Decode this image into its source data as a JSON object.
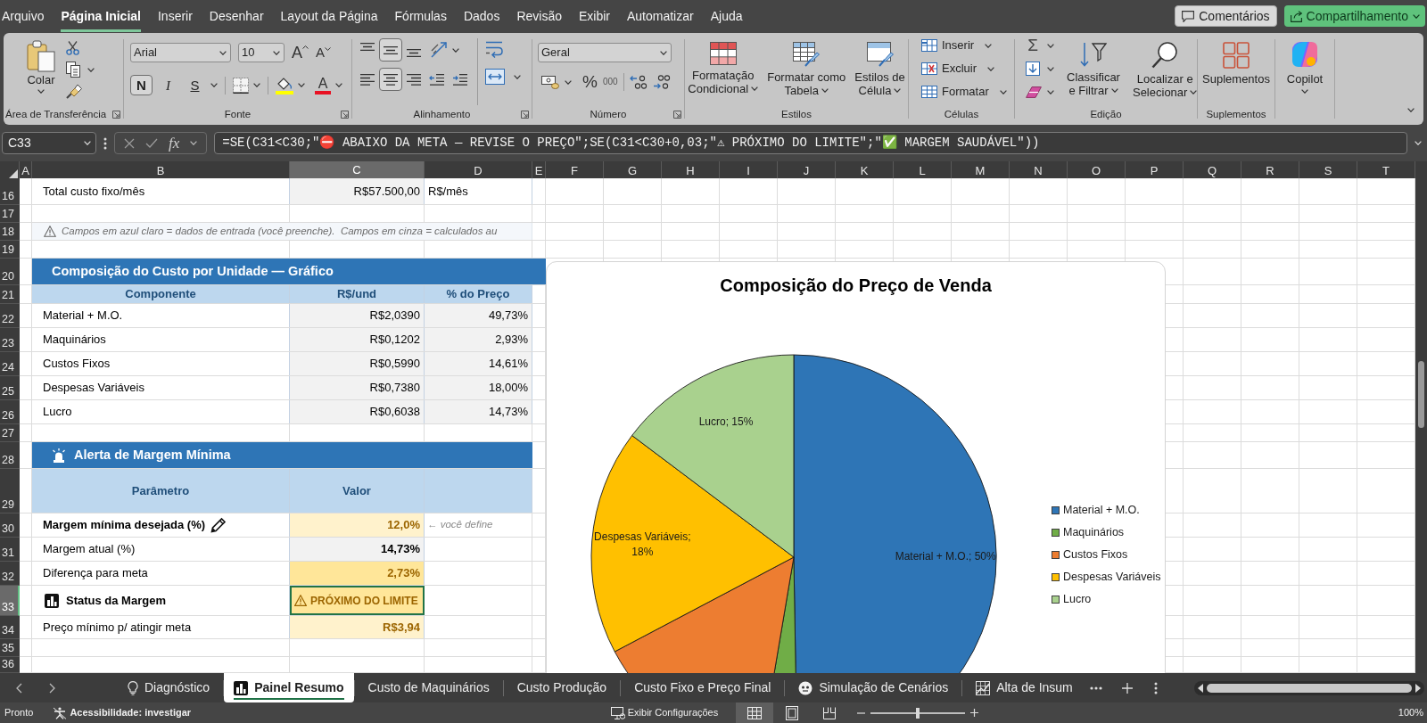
{
  "menu_tabs": [
    {
      "label": "Arquivo",
      "selected": false
    },
    {
      "label": "Página Inicial",
      "selected": true
    },
    {
      "label": "Inserir",
      "selected": false
    },
    {
      "label": "Desenhar",
      "selected": false
    },
    {
      "label": "Layout da Página",
      "selected": false
    },
    {
      "label": "Fórmulas",
      "selected": false
    },
    {
      "label": "Dados",
      "selected": false
    },
    {
      "label": "Revisão",
      "selected": false
    },
    {
      "label": "Exibir",
      "selected": false
    },
    {
      "label": "Automatizar",
      "selected": false
    },
    {
      "label": "Ajuda",
      "selected": false
    }
  ],
  "header_buttons": [
    {
      "kind": "comments",
      "label": "Comentários"
    },
    {
      "kind": "share",
      "label": "Compartilhamento"
    }
  ],
  "ribbon": {
    "groups": [
      {
        "kind": "clipboard",
        "label": "Área de Transferência",
        "launcher": true,
        "paste": "Colar"
      },
      {
        "kind": "font",
        "label": "Fonte",
        "launcher": true,
        "font_name": "Arial",
        "font_size": "10",
        "grow": "A",
        "shrink": "A",
        "styles": [
          {
            "kind": "bold",
            "label": "N",
            "selected": true
          },
          {
            "kind": "italic",
            "label": "I",
            "selected": false
          },
          {
            "kind": "underline",
            "label": "S",
            "selected": false
          }
        ],
        "font_color": "A"
      },
      {
        "kind": "alignment",
        "label": "Alinhamento",
        "launcher": true,
        "vertical": [
          {
            "kind": "top",
            "selected": false
          },
          {
            "kind": "middle",
            "selected": true
          },
          {
            "kind": "bottom",
            "selected": false
          }
        ],
        "horizontal": [
          {
            "kind": "left",
            "selected": false
          },
          {
            "kind": "center",
            "selected": true
          },
          {
            "kind": "right",
            "selected": false
          }
        ]
      },
      {
        "kind": "number",
        "label": "Número",
        "launcher": true,
        "format": "Geral",
        "percent": "%",
        "thousands": "000"
      },
      {
        "kind": "styles",
        "label": "Estilos",
        "buttons": [
          {
            "kind": "conditional",
            "lines": [
              "Formatação",
              "Condicional"
            ]
          },
          {
            "kind": "table",
            "lines": [
              "Formatar como",
              "Tabela"
            ]
          },
          {
            "kind": "cell_styles",
            "lines": [
              "Estilos de",
              "Célula"
            ]
          }
        ]
      },
      {
        "kind": "cells",
        "label": "Células",
        "buttons": [
          {
            "kind": "insert",
            "label": "Inserir"
          },
          {
            "kind": "delete",
            "label": "Excluir"
          },
          {
            "kind": "format",
            "label": "Formatar"
          }
        ]
      },
      {
        "kind": "editing",
        "label": "Edição",
        "sum": "Σ",
        "buttons": [
          {
            "kind": "sort",
            "lines": [
              "Classificar",
              "e Filtrar"
            ]
          },
          {
            "kind": "find",
            "lines": [
              "Localizar e",
              "Selecionar"
            ]
          }
        ]
      },
      {
        "kind": "addins",
        "label": "Suplementos",
        "button": "Suplementos"
      },
      {
        "kind": "copilot",
        "button": "Copilot"
      }
    ]
  },
  "formula_bar": {
    "name_box": "C33",
    "function_label": "fx",
    "formula": "=SE(C31<C30;\"⛔ ABAIXO DA META — REVISE O PREÇO\";SE(C31<C30+0,03;\"⚠ PRÓXIMO DO LIMITE\";\"✅ MARGEM SAUDÁVEL\"))"
  },
  "columns": [
    {
      "label": "A",
      "selected": false
    },
    {
      "label": "B",
      "selected": false
    },
    {
      "label": "C",
      "selected": true
    },
    {
      "label": "D",
      "selected": false
    },
    {
      "label": "E",
      "selected": false
    },
    {
      "label": "F",
      "selected": false
    },
    {
      "label": "G",
      "selected": false
    },
    {
      "label": "H",
      "selected": false
    },
    {
      "label": "I",
      "selected": false
    },
    {
      "label": "J",
      "selected": false
    },
    {
      "label": "K",
      "selected": false
    },
    {
      "label": "L",
      "selected": false
    },
    {
      "label": "M",
      "selected": false
    },
    {
      "label": "N",
      "selected": false
    },
    {
      "label": "O",
      "selected": false
    },
    {
      "label": "P",
      "selected": false
    },
    {
      "label": "Q",
      "selected": false
    },
    {
      "label": "R",
      "selected": false
    },
    {
      "label": "S",
      "selected": false
    },
    {
      "label": "T",
      "selected": false
    }
  ],
  "rows": [
    {
      "number": "16",
      "kind": "total",
      "selected": false,
      "label": "Total custo fixo/mês",
      "value": "R$57.500,00",
      "unit": "R$/mês"
    },
    {
      "number": "17",
      "kind": "blank",
      "selected": false
    },
    {
      "number": "18",
      "kind": "note",
      "selected": false,
      "text": "Campos em azul claro = dados de entrada (você preenche).  Campos em cinza = calculados au"
    },
    {
      "number": "19",
      "kind": "blank",
      "selected": false
    },
    {
      "number": "20",
      "kind": "section",
      "selected": false,
      "title": "Composição do Custo por Unidade — Gráfico"
    },
    {
      "number": "21",
      "kind": "table_header",
      "selected": false,
      "cells": [
        "Componente",
        "R$/und",
        "% do Preço"
      ]
    },
    {
      "number": "22",
      "kind": "item",
      "selected": false,
      "label": "Material + M.O.",
      "value": "R$2,0390",
      "share": "49,73%"
    },
    {
      "number": "23",
      "kind": "item",
      "selected": false,
      "label": "Maquinários",
      "value": "R$0,1202",
      "share": "2,93%"
    },
    {
      "number": "24",
      "kind": "item",
      "selected": false,
      "label": "Custos Fixos",
      "value": "R$0,5990",
      "share": "14,61%"
    },
    {
      "number": "25",
      "kind": "item",
      "selected": false,
      "label": "Despesas Variáveis",
      "value": "R$0,7380",
      "share": "18,00%"
    },
    {
      "number": "26",
      "kind": "item",
      "selected": false,
      "label": "Lucro",
      "value": "R$0,6038",
      "share": "14,73%"
    },
    {
      "number": "27",
      "kind": "blank",
      "selected": false
    },
    {
      "number": "28",
      "kind": "alert_section",
      "selected": false,
      "title": "Alerta de Margem Mínima"
    },
    {
      "number": "29",
      "kind": "param_header",
      "selected": false,
      "cells": [
        "Parâmetro",
        "Valor"
      ]
    },
    {
      "number": "30",
      "kind": "input_param",
      "selected": false,
      "label": "Margem mínima desejada (%)",
      "value": "12,0%",
      "note": "← você define"
    },
    {
      "number": "31",
      "kind": "calc_param",
      "selected": false,
      "label": "Margem atual (%)",
      "value": "14,73%"
    },
    {
      "number": "32",
      "kind": "gap_param",
      "selected": false,
      "label": "Diferença para meta",
      "value": "2,73%"
    },
    {
      "number": "33",
      "kind": "status_param",
      "selected": true,
      "label": "Status da Margem",
      "value": "PRÓXIMO DO LIMITE"
    },
    {
      "number": "34",
      "kind": "target_param",
      "selected": false,
      "label": "Preço mínimo p/ atingir meta",
      "value": "R$3,94"
    },
    {
      "number": "35",
      "kind": "blank",
      "selected": false
    },
    {
      "number": "36",
      "kind": "blank",
      "selected": false
    }
  ],
  "chart": {
    "chart_data": {
      "type": "pie",
      "title": "Composição do Preço de Venda",
      "categories": [
        "Material + M.O.",
        "Maquinários",
        "Custos Fixos",
        "Despesas Variáveis",
        "Lucro"
      ],
      "values": [
        49.73,
        2.93,
        14.61,
        18.0,
        14.73
      ],
      "value_labels": [
        "Material + M.O.; 50%",
        null,
        null,
        "Despesas Variáveis; 18%",
        "Lucro; 15%"
      ],
      "legend": "right"
    },
    "slices": [
      {
        "color": "#2e75b6"
      },
      {
        "color": "#70ad47"
      },
      {
        "color": "#ed7d31"
      },
      {
        "color": "#ffc000"
      },
      {
        "color": "#a9d18e"
      }
    ]
  },
  "sheet_tabs": [
    {
      "label": "Diagnóstico",
      "kind": "bulb",
      "selected": false
    },
    {
      "label": "Painel Resumo",
      "kind": "chart",
      "selected": true
    },
    {
      "label": "Custo de Maquinários",
      "kind": "plain",
      "selected": false
    },
    {
      "label": "Custo Produção",
      "kind": "plain",
      "selected": false
    },
    {
      "label": "Custo Fixo e Preço Final",
      "kind": "plain",
      "selected": false
    },
    {
      "label": "Simulação de Cenários",
      "kind": "emoji",
      "selected": false
    },
    {
      "label": "Alta de Insum",
      "kind": "graph",
      "selected": false
    }
  ],
  "status_bar": {
    "mode": "Pronto",
    "accessibility": "Acessibilidade: investigar",
    "display_settings": "Exibir Configurações",
    "views": [
      {
        "kind": "normal",
        "selected": true
      },
      {
        "kind": "page_layout",
        "selected": false
      },
      {
        "kind": "page_break",
        "selected": false
      }
    ],
    "zoom": {
      "level": 0.5,
      "reading": "100%"
    }
  }
}
